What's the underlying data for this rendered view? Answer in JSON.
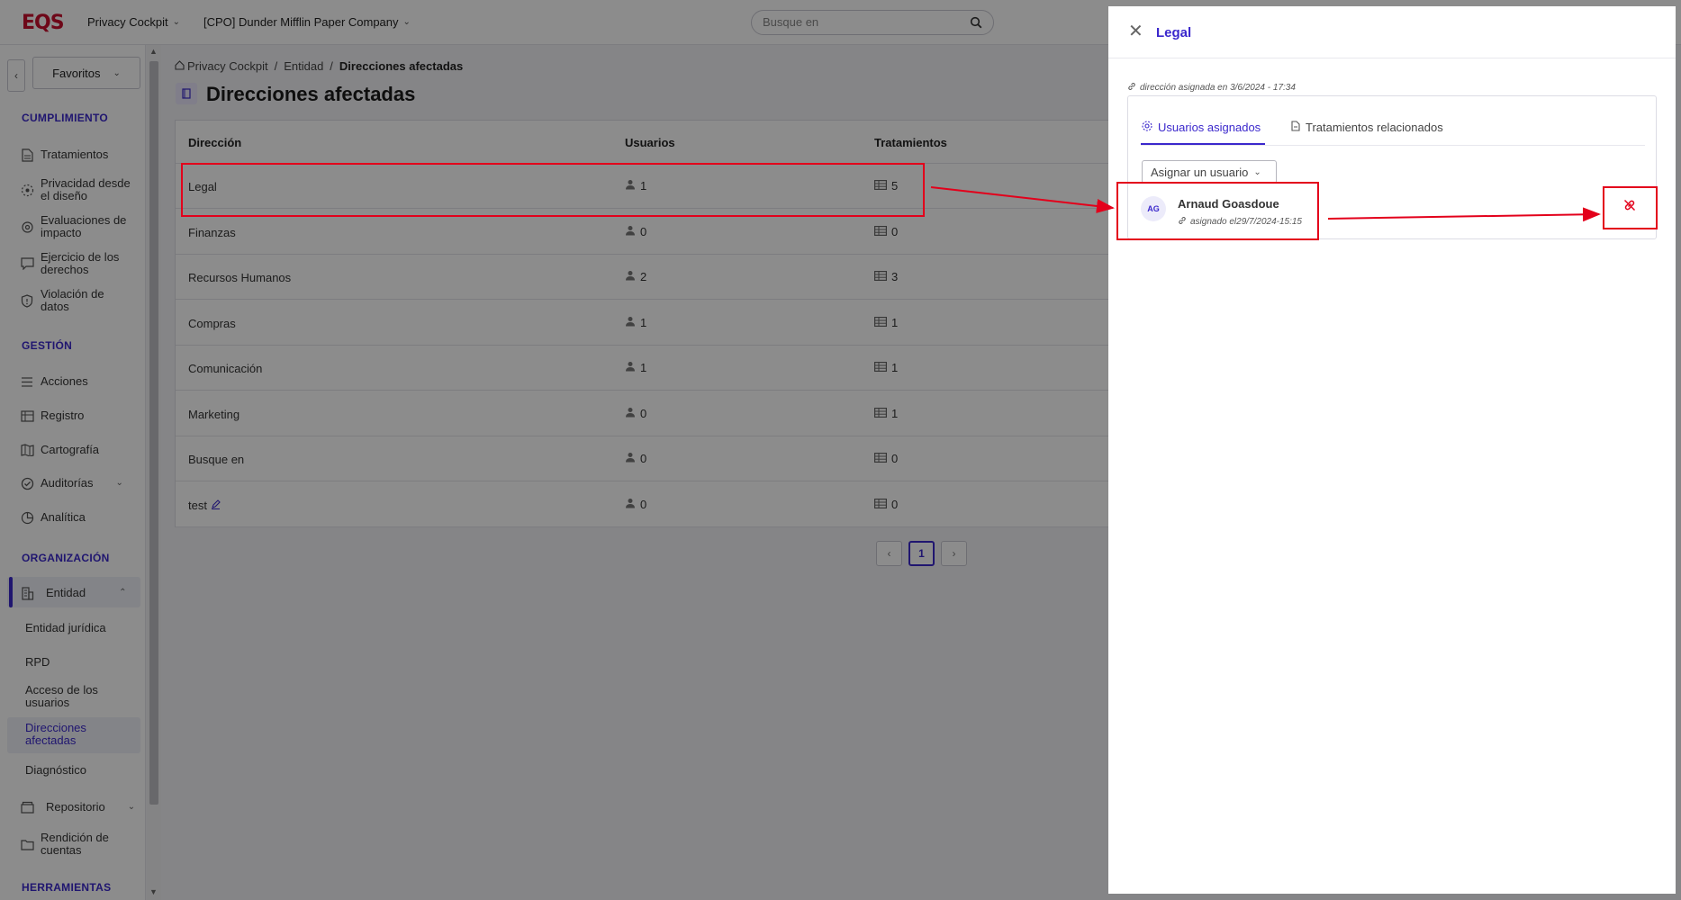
{
  "topbar": {
    "logo": "EQS",
    "app_menu": "Privacy Cockpit",
    "company_menu": "[CPO] Dunder Mifflin Paper Company",
    "search_placeholder": "Busque en"
  },
  "sidebar": {
    "favorites_label": "Favoritos",
    "sections": {
      "cumplimiento": "CUMPLIMIENTO",
      "gestion": "GESTIÓN",
      "organizacion": "ORGANIZACIÓN",
      "herramientas": "HERRAMIENTAS"
    },
    "items": {
      "tratamientos": "Tratamientos",
      "privacidad_l1": "Privacidad desde",
      "privacidad_l2": "el diseño",
      "evaluaciones_l1": "Evaluaciones de",
      "evaluaciones_l2": "impacto",
      "ejercicio_l1": "Ejercicio de los",
      "ejercicio_l2": "derechos",
      "violacion_l1": "Violación de",
      "violacion_l2": "datos",
      "acciones": "Acciones",
      "registro": "Registro",
      "cartografia": "Cartografía",
      "auditorias": "Auditorías",
      "analitica": "Analítica",
      "entidad": "Entidad",
      "repositorio": "Repositorio",
      "rendicion_l1": "Rendición de",
      "rendicion_l2": "cuentas"
    },
    "entidad_sub": {
      "entidad_juridica": "Entidad jurídica",
      "rpd": "RPD",
      "acceso_l1": "Acceso de los",
      "acceso_l2": "usuarios",
      "direcciones_l1": "Direcciones",
      "direcciones_l2": "afectadas",
      "diagnostico": "Diagnóstico"
    }
  },
  "main": {
    "breadcrumb": {
      "home": "Privacy Cockpit",
      "sep": "/",
      "entidad": "Entidad",
      "current": "Direcciones afectadas"
    },
    "title": "Direcciones afectadas",
    "table": {
      "headers": [
        "Dirección",
        "Usuarios",
        "Tratamientos"
      ],
      "rows": [
        {
          "direccion": "Legal",
          "usuarios": "1",
          "tratamientos": "5"
        },
        {
          "direccion": "Finanzas",
          "usuarios": "0",
          "tratamientos": "0"
        },
        {
          "direccion": "Recursos Humanos",
          "usuarios": "2",
          "tratamientos": "3"
        },
        {
          "direccion": "Compras",
          "usuarios": "1",
          "tratamientos": "1"
        },
        {
          "direccion": "Comunicación",
          "usuarios": "1",
          "tratamientos": "1"
        },
        {
          "direccion": "Marketing",
          "usuarios": "0",
          "tratamientos": "1"
        },
        {
          "direccion": "Busque en",
          "usuarios": "0",
          "tratamientos": "0"
        },
        {
          "direccion": "test",
          "usuarios": "0",
          "tratamientos": "0"
        }
      ]
    },
    "pagination": {
      "prev": "‹",
      "page": "1",
      "next": "›"
    }
  },
  "drawer": {
    "title": "Legal",
    "assigned_on": "dirección asignada en 3/6/2024 - 17:34",
    "tabs": {
      "usuarios": "Usuarios asignados",
      "tratamientos": "Tratamientos relacionados"
    },
    "assign_select": "Asignar un usuario",
    "user": {
      "initials": "AG",
      "name": "Arnaud Goasdoue",
      "assigned": "asignado el29/7/2024-15:15"
    }
  },
  "colors": {
    "accent": "#3b28cc",
    "brand": "#c8102e",
    "annotation": "#e3001b"
  }
}
